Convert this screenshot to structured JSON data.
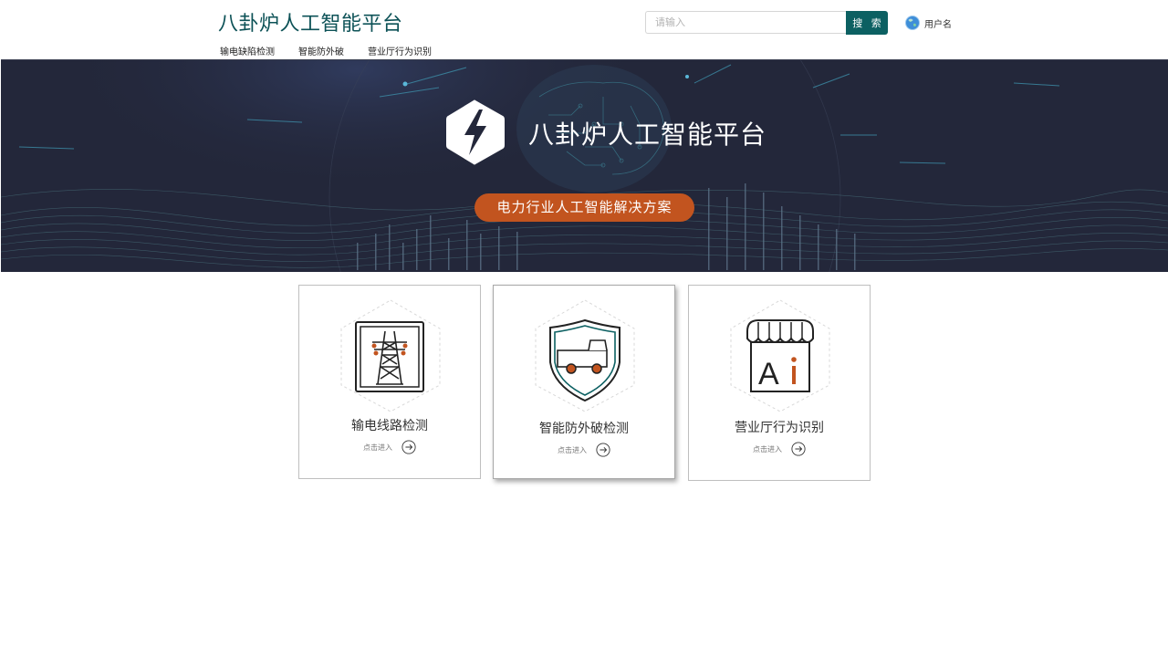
{
  "header": {
    "title": "八卦炉人工智能平台",
    "nav": [
      "输电缺陷检测",
      "智能防外破",
      "营业厅行为识别"
    ],
    "search": {
      "placeholder": "请输入",
      "value": "",
      "button_label": "搜 索"
    },
    "user": {
      "name": "用户名",
      "avatar_icon": "globe-avatar-icon"
    }
  },
  "banner": {
    "title": "八卦炉人工智能平台",
    "subtitle": "电力行业人工智能解决方案",
    "logo_icon": "lightning-hexagon-icon",
    "colors": {
      "background": "#23273a",
      "pill": "#c2541f"
    }
  },
  "cards": [
    {
      "label": "输电线路检测",
      "enter_label": "点击进入",
      "icon": "transmission-tower-icon"
    },
    {
      "label": "智能防外破检测",
      "enter_label": "点击进入",
      "icon": "truck-shield-icon"
    },
    {
      "label": "营业厅行为识别",
      "enter_label": "点击进入",
      "icon": "shop-ai-icon"
    }
  ],
  "colors": {
    "accent": "#0c6062",
    "title": "#0d5257",
    "highlight": "#c2541f"
  }
}
